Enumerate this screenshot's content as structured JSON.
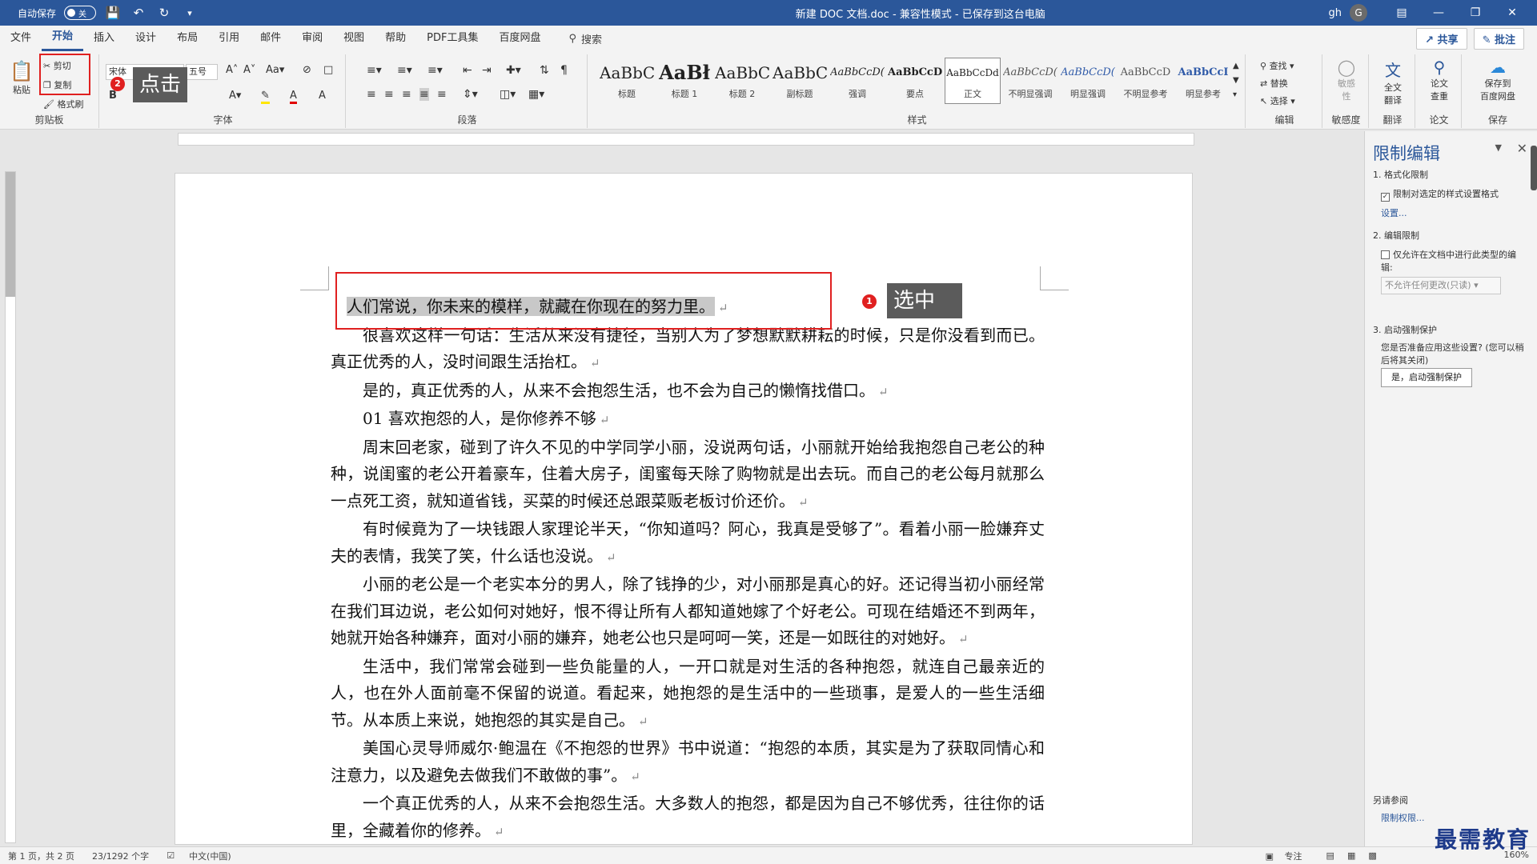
{
  "titlebar": {
    "autosave_label": "自动保存",
    "autosave_state": "关",
    "doc_title": "新建 DOC 文档.doc  -  兼容性模式  -  已保存到这台电脑",
    "user_name": "gh",
    "avatar_initial": "G"
  },
  "menu": {
    "tabs": [
      "文件",
      "开始",
      "插入",
      "设计",
      "布局",
      "引用",
      "邮件",
      "审阅",
      "视图",
      "帮助",
      "PDF工具集",
      "百度网盘"
    ],
    "active_tab": "开始",
    "search_label": "搜索",
    "share_label": "共享",
    "comment_label": "批注"
  },
  "ribbon": {
    "clipboard": {
      "paste": "粘贴",
      "cut": "剪切",
      "copy": "复制",
      "format_painter": "格式刷",
      "group": "剪贴板"
    },
    "font": {
      "name": "宋体",
      "size": "五号",
      "group": "字体"
    },
    "paragraph": {
      "group": "段落"
    },
    "styles": {
      "group": "样式",
      "items": [
        {
          "sample": "AaBbC(",
          "name": "标题"
        },
        {
          "sample": "AaBł",
          "name": "标题 1"
        },
        {
          "sample": "AaBbC(",
          "name": "标题 2"
        },
        {
          "sample": "AaBbC(",
          "name": "副标题"
        },
        {
          "sample": "AaBbCcD(",
          "name": "强调"
        },
        {
          "sample": "AaBbCcD",
          "name": "要点"
        },
        {
          "sample": "AaBbCcDd",
          "name": "正文"
        },
        {
          "sample": "AaBbCcD(",
          "name": "不明显强调"
        },
        {
          "sample": "AaBbCcD(",
          "name": "明显强调"
        },
        {
          "sample": "AaBbCcD",
          "name": "不明显参考"
        },
        {
          "sample": "AaBbCcI",
          "name": "明显参考"
        }
      ]
    },
    "editing": {
      "find": "查找",
      "replace": "替换",
      "select": "选择",
      "group": "编辑"
    },
    "sensitivity": {
      "label": "敏感\n性",
      "group": "敏感度"
    },
    "translate": {
      "label": "全文\n翻译",
      "group": "翻译"
    },
    "paper": {
      "label": "论文\n查重",
      "group": "论文"
    },
    "save": {
      "label": "保存到\n百度网盘",
      "group": "保存"
    }
  },
  "document": {
    "paragraphs": [
      "人们常说，你未来的模样，就藏在你现在的努力里。",
      "很喜欢这样一句话：生活从来没有捷径，当别人为了梦想默默耕耘的时候，只是你没看到而已。真正优秀的人，没时间跟生活抬杠。",
      "是的，真正优秀的人，从来不会抱怨生活，也不会为自己的懒惰找借口。",
      "01  喜欢抱怨的人，是你修养不够",
      "周末回老家，碰到了许久不见的中学同学小丽，没说两句话，小丽就开始给我抱怨自己老公的种种，说闺蜜的老公开着豪车，住着大房子，闺蜜每天除了购物就是出去玩。而自己的老公每月就那么一点死工资，就知道省钱，买菜的时候还总跟菜贩老板讨价还价。",
      "有时候竟为了一块钱跟人家理论半天，“你知道吗？阿心，我真是受够了”。看着小丽一脸嫌弃丈夫的表情，我笑了笑，什么话也没说。",
      "小丽的老公是一个老实本分的男人，除了钱挣的少，对小丽那是真心的好。还记得当初小丽经常在我们耳边说，老公如何对她好，恨不得让所有人都知道她嫁了个好老公。可现在结婚还不到两年，她就开始各种嫌弃，面对小丽的嫌弃，她老公也只是呵呵一笑，还是一如既往的对她好。",
      "生活中，我们常常会碰到一些负能量的人，一开口就是对生活的各种抱怨，就连自己最亲近的人，也在外人面前毫不保留的说道。看起来，她抱怨的是生活中的一些琐事，是爱人的一些生活细节。从本质上来说，她抱怨的其实是自己。",
      "美国心灵导师威尔·鲍温在《不抱怨的世界》书中说道：“抱怨的本质，其实是为了获取同情心和注意力，以及避免去做我们不敢做的事”。",
      "一个真正优秀的人，从来不会抱怨生活。大多数人的抱怨，都是因为自己不够优秀，往往你的话里，全藏着你的修养。"
    ]
  },
  "annotations": {
    "click_label": "点击",
    "click_num": "2",
    "select_label": "选中",
    "select_num": "1"
  },
  "panel": {
    "title": "限制编辑",
    "sec1": "1. 格式化限制",
    "sec1_check": "限制对选定的样式设置格式",
    "sec1_link": "设置...",
    "sec2": "2. 编辑限制",
    "sec2_check": "仅允许在文档中进行此类型的编辑:",
    "sec2_select": "不允许任何更改(只读)",
    "sec3": "3. 启动强制保护",
    "sec3_text": "您是否准备应用这些设置? (您可以稍后将其关闭)",
    "sec3_button": "是，启动强制保护",
    "see_also": "另请参阅",
    "perm_link": "限制权限..."
  },
  "status": {
    "page": "第 1 页，共 2 页",
    "words": "23/1292 个字",
    "lang": "中文(中国)",
    "focus": "专注",
    "zoom": "160%"
  },
  "watermark": "最需教育"
}
